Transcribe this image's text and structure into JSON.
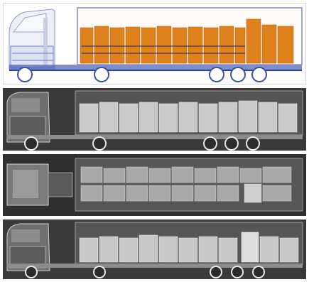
{
  "figure": {
    "panels": [
      {
        "id": "color-side-view",
        "mode": "color-dual-energy",
        "view": "side"
      },
      {
        "id": "gray-side-view",
        "mode": "grayscale",
        "view": "side"
      },
      {
        "id": "gray-top-view",
        "mode": "grayscale",
        "view": "top"
      },
      {
        "id": "gray-side-view-2",
        "mode": "grayscale",
        "view": "side"
      }
    ],
    "colors": {
      "background": "#ffffff",
      "organic_cargo": "#e0821c",
      "metal_outline": "#3b4fa8",
      "gray_background": "#2e2e2e",
      "gray_cargo": "#bdbdbd"
    }
  }
}
